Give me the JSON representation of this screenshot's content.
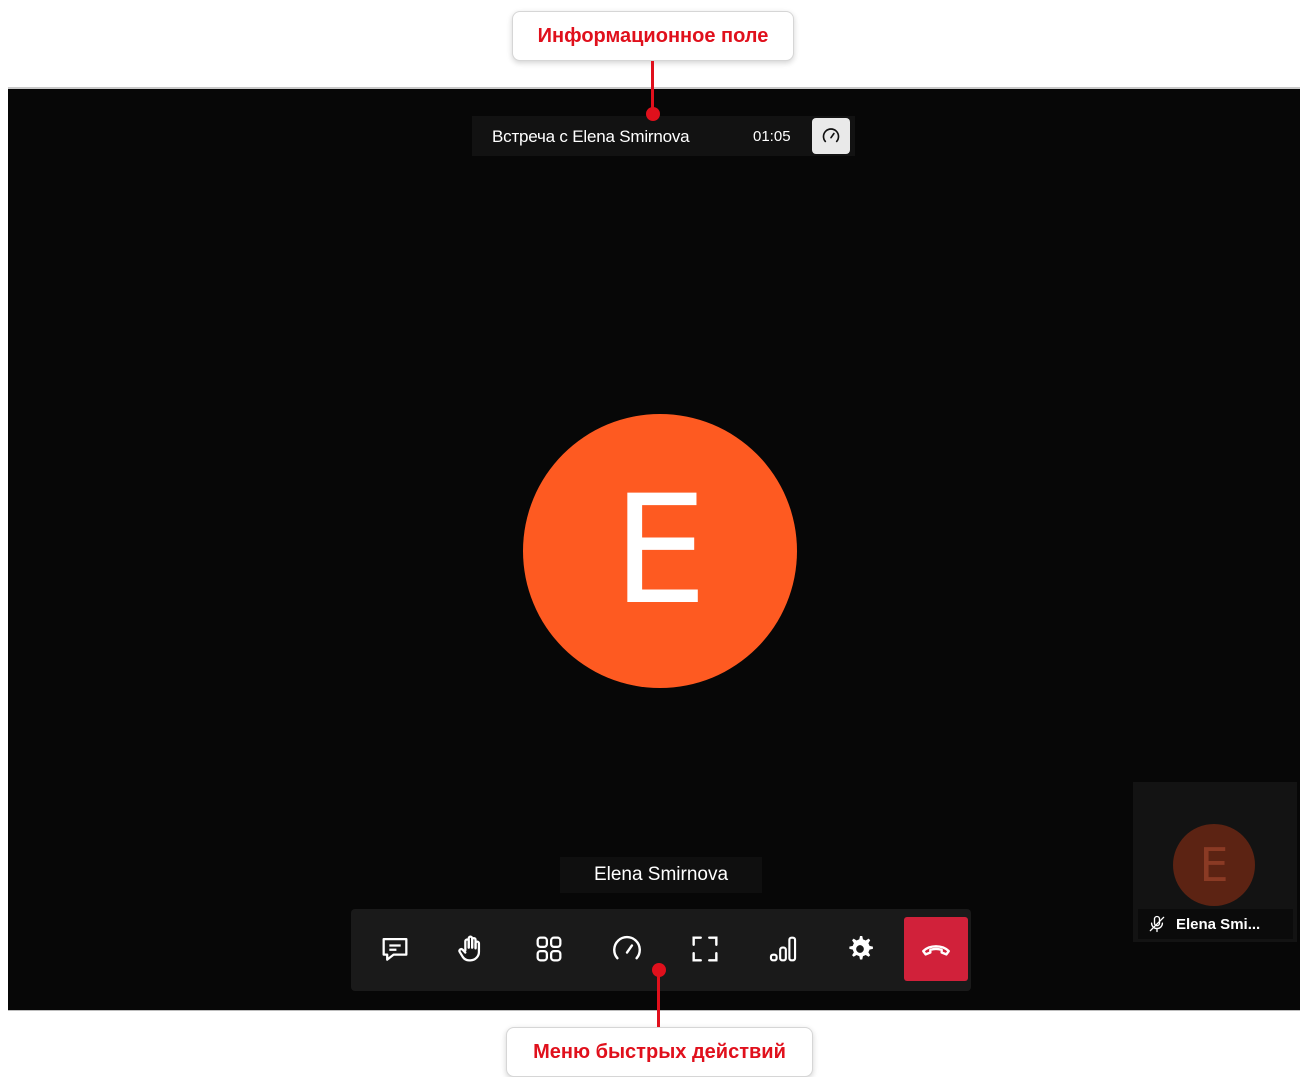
{
  "annotations": {
    "top_label": "Информационное поле",
    "bottom_label": "Меню быстрых действий",
    "accent_color": "#e0101c"
  },
  "info_bar": {
    "meeting_title": "Встреча с Elena Smirnova",
    "timer": "01:05",
    "speed_icon": "speedometer-icon"
  },
  "main_participant": {
    "initial": "E",
    "name": "Elena Smirnova",
    "avatar_color": "#fe5a21"
  },
  "toolbar": {
    "buttons": [
      {
        "name": "chat-button",
        "icon": "chat-bubble-icon"
      },
      {
        "name": "raise-hand-button",
        "icon": "hand-icon"
      },
      {
        "name": "layout-grid-button",
        "icon": "grid-icon"
      },
      {
        "name": "connection-speed-button",
        "icon": "speedometer-icon"
      },
      {
        "name": "fullscreen-button",
        "icon": "fullscreen-icon"
      },
      {
        "name": "signal-quality-button",
        "icon": "signal-bars-icon"
      },
      {
        "name": "settings-button",
        "icon": "gear-icon"
      },
      {
        "name": "hang-up-button",
        "icon": "phone-hangup-icon"
      }
    ],
    "hangup_color": "#d1213a"
  },
  "self_view": {
    "initial": "E",
    "name": "Elena Smi...",
    "mic_icon": "mic-muted-icon"
  }
}
